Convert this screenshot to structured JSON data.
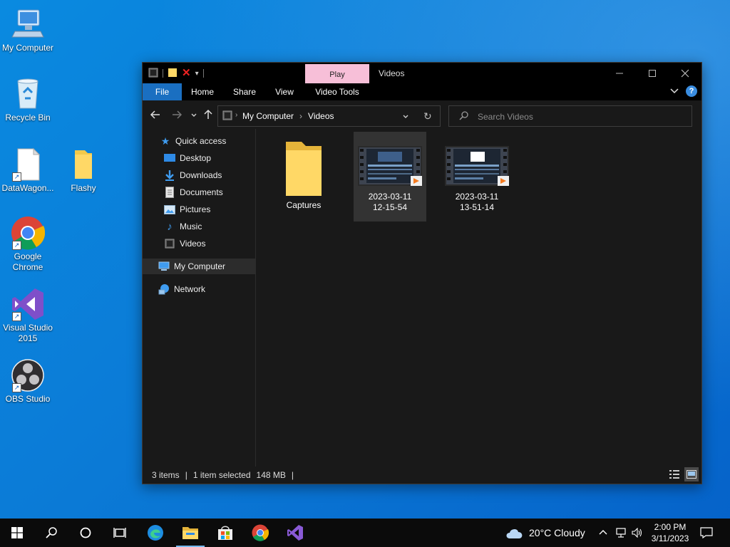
{
  "desktop": {
    "icons": [
      {
        "label": "My Computer"
      },
      {
        "label": "Recycle Bin"
      },
      {
        "label": "DataWagon..."
      },
      {
        "label": "Flashy"
      },
      {
        "label": "Google Chrome"
      },
      {
        "label": "Visual Studio 2015"
      },
      {
        "label": "OBS Studio"
      }
    ]
  },
  "window": {
    "title": "Videos",
    "contextual_tab": "Play",
    "ribbon_tabs": [
      "File",
      "Home",
      "Share",
      "View",
      "Video Tools"
    ],
    "breadcrumb": [
      "My Computer",
      "Videos"
    ],
    "search_placeholder": "Search Videos",
    "sidebar": {
      "items": [
        {
          "label": "Quick access"
        },
        {
          "label": "Desktop"
        },
        {
          "label": "Downloads"
        },
        {
          "label": "Documents"
        },
        {
          "label": "Pictures"
        },
        {
          "label": "Music"
        },
        {
          "label": "Videos"
        },
        {
          "label": "My Computer"
        },
        {
          "label": "Network"
        }
      ]
    },
    "files": [
      {
        "name": "Captures",
        "type": "folder"
      },
      {
        "name": "2023-03-11 12-15-54",
        "line1": "2023-03-11",
        "line2": "12-15-54",
        "type": "video"
      },
      {
        "name": "2023-03-11 13-51-14",
        "line1": "2023-03-11",
        "line2": "13-51-14",
        "type": "video"
      }
    ],
    "status": {
      "count": "3 items",
      "selection": "1 item selected",
      "size": "148 MB"
    }
  },
  "taskbar": {
    "weather": "20°C  Cloudy",
    "time": "2:00 PM",
    "date": "3/11/2023"
  },
  "colors": {
    "desktop_blue": "#0a7ad6",
    "accent": "#1a6fc1",
    "play_tab": "#f7bfd8",
    "explorer_bg": "#191919"
  }
}
